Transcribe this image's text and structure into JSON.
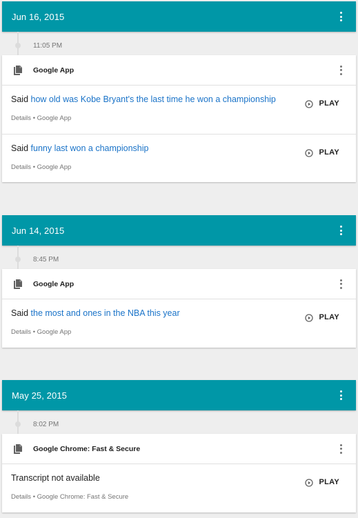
{
  "groups": [
    {
      "date": "Jun 16, 2015",
      "time": "11:05 PM",
      "app_name": "Google App",
      "entries": [
        {
          "prefix": "Said",
          "query": "how old was Kobe Bryant's the last time he won a championship",
          "details_label": "Details",
          "separator": "•",
          "source": "Google App",
          "play_label": "PLAY"
        },
        {
          "prefix": "Said",
          "query": "funny last won a championship",
          "details_label": "Details",
          "separator": "•",
          "source": "Google App",
          "play_label": "PLAY"
        }
      ]
    },
    {
      "date": "Jun 14, 2015",
      "time": "8:45 PM",
      "app_name": "Google App",
      "entries": [
        {
          "prefix": "Said",
          "query": "the most and ones in the NBA this year",
          "details_label": "Details",
          "separator": "•",
          "source": "Google App",
          "play_label": "PLAY"
        }
      ]
    },
    {
      "date": "May 25, 2015",
      "time": "8:02 PM",
      "app_name": "Google Chrome: Fast & Secure",
      "entries": [
        {
          "transcript": "Transcript not available",
          "details_label": "Details",
          "separator": "•",
          "source": "Google Chrome: Fast & Secure",
          "play_label": "PLAY"
        }
      ]
    }
  ],
  "icons": {
    "app": "file-copy-icon",
    "more": "more-vert-icon",
    "play": "play-circle-icon"
  },
  "colors": {
    "header": "#0097a7",
    "link": "#1a73c8",
    "background": "#eeeeee"
  }
}
